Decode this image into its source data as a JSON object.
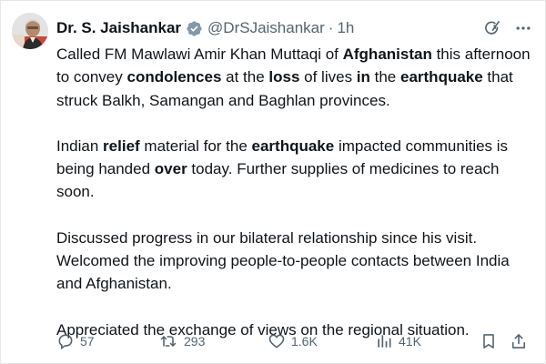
{
  "author": {
    "name": "Dr. S. Jaishankar",
    "handle": "@DrSJaishankar",
    "separator": "·",
    "time": "1h"
  },
  "icons": {
    "avatar": "profile-photo",
    "verified": "verified-badge-icon",
    "grok": "grok-icon",
    "more": "more-icon",
    "reply": "reply-icon",
    "repost": "repost-icon",
    "like": "like-icon",
    "views": "views-icon",
    "bookmark": "bookmark-icon",
    "share": "share-icon"
  },
  "colors": {
    "text": "#0f1419",
    "muted": "#536471",
    "verified_badge": "#829aab"
  },
  "paragraphs": [
    [
      {
        "t": "Called FM Mawlawi Amir Khan Muttaqi of "
      },
      {
        "t": "Afghanistan",
        "b": true
      },
      {
        "t": " this afternoon to convey "
      },
      {
        "t": "condolences",
        "b": true
      },
      {
        "t": " at the "
      },
      {
        "t": "loss",
        "b": true
      },
      {
        "t": " of lives "
      },
      {
        "t": "in",
        "b": true
      },
      {
        "t": " the "
      },
      {
        "t": "earthquake",
        "b": true
      },
      {
        "t": " that struck Balkh, Samangan and Baghlan provinces."
      }
    ],
    [
      {
        "t": "Indian "
      },
      {
        "t": "relief",
        "b": true
      },
      {
        "t": " material for the "
      },
      {
        "t": "earthquake",
        "b": true
      },
      {
        "t": " impacted communities is being handed "
      },
      {
        "t": "over",
        "b": true
      },
      {
        "t": " today. Further supplies of medicines to reach soon."
      }
    ],
    [
      {
        "t": "Discussed progress in our bilateral relationship since his visit. Welcomed the improving people-to-people contacts between India and Afghanistan."
      }
    ],
    [
      {
        "t": "Appreciated the exchange of views on the regional situation."
      }
    ]
  ],
  "stats": {
    "replies": "57",
    "reposts": "293",
    "likes": "1.6K",
    "views": "41K"
  }
}
